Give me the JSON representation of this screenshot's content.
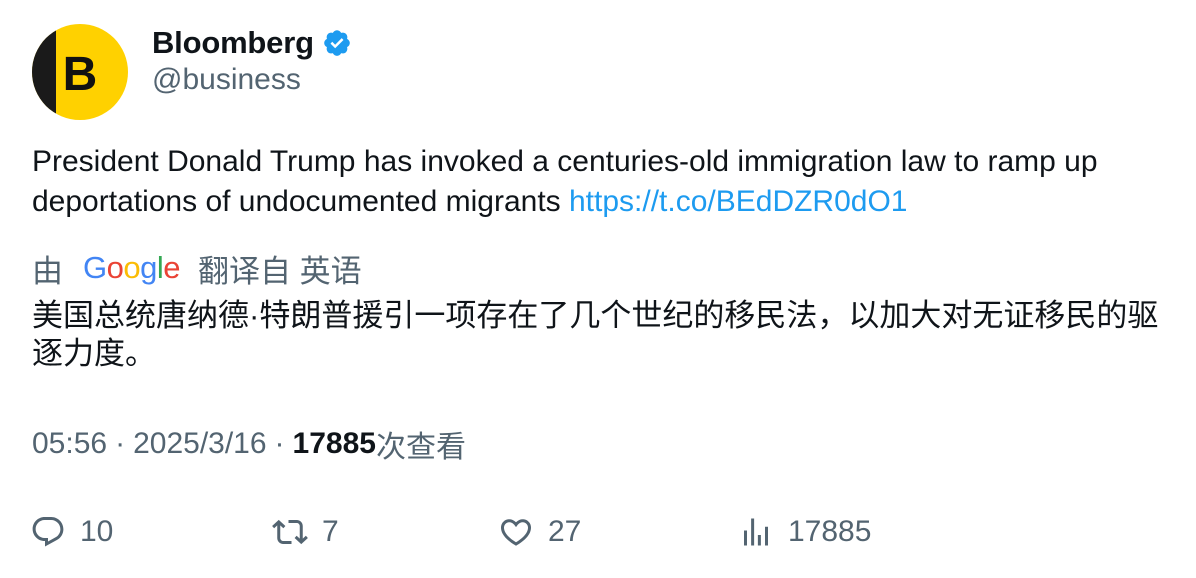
{
  "author": {
    "display_name": "Bloomberg",
    "handle": "@business",
    "avatar_letter": "B",
    "avatar_color": "#ffd100",
    "verified_color": "#1d9bf0"
  },
  "tweet": {
    "text": "President Donald Trump has invoked a centuries-old immigration law to ramp up deportations of undocumented migrants ",
    "link": "https://t.co/BEdDZR0dO1"
  },
  "translation": {
    "prefix": "由",
    "provider": "Google",
    "suffix": "翻译自 英语",
    "text": "美国总统唐纳德·特朗普援引一项存在了几个世纪的移民法，以加大对无证移民的驱逐力度。"
  },
  "meta": {
    "time": "05:56",
    "separator": "·",
    "date": "2025/3/16",
    "views": "17885",
    "views_label": "次查看"
  },
  "actions": {
    "replies": "10",
    "retweets": "7",
    "likes": "27",
    "views": "17885"
  }
}
